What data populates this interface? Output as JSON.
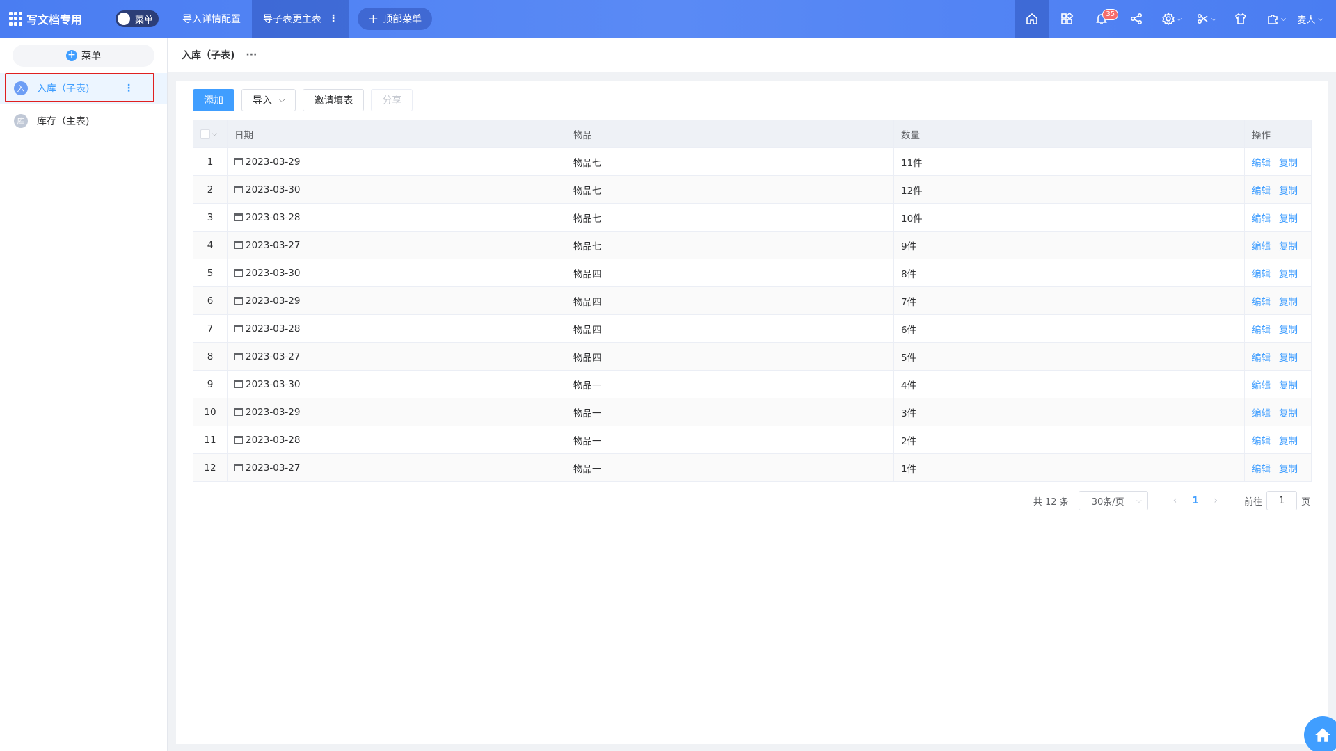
{
  "app": {
    "title": "写文档专用",
    "menu_toggle_label": "菜单"
  },
  "top_nav": {
    "tabs": [
      {
        "label": "导入详情配置"
      },
      {
        "label": "导子表更主表",
        "more": "⋮"
      }
    ],
    "add_menu_label": "顶部菜单",
    "notification_count": "35",
    "user_label": "麦人"
  },
  "sidebar": {
    "menu_button_label": "菜单",
    "items": [
      {
        "avatar": "入",
        "label": "入库（子表)",
        "more": "⋮"
      },
      {
        "avatar": "库",
        "label": "库存（主表)"
      }
    ]
  },
  "breadcrumb": {
    "title": "入库（子表)",
    "more": "···"
  },
  "toolbar": {
    "add_label": "添加",
    "import_label": "导入",
    "invite_label": "邀请填表",
    "share_label": "分享"
  },
  "table": {
    "columns": [
      "日期",
      "物品",
      "数量",
      "操作"
    ],
    "action_labels": {
      "edit": "编辑",
      "copy": "复制"
    },
    "rows": [
      {
        "no": "1",
        "date": "2023-03-29",
        "item": "物品七",
        "qty": "11件"
      },
      {
        "no": "2",
        "date": "2023-03-30",
        "item": "物品七",
        "qty": "12件"
      },
      {
        "no": "3",
        "date": "2023-03-28",
        "item": "物品七",
        "qty": "10件"
      },
      {
        "no": "4",
        "date": "2023-03-27",
        "item": "物品七",
        "qty": "9件"
      },
      {
        "no": "5",
        "date": "2023-03-30",
        "item": "物品四",
        "qty": "8件"
      },
      {
        "no": "6",
        "date": "2023-03-29",
        "item": "物品四",
        "qty": "7件"
      },
      {
        "no": "7",
        "date": "2023-03-28",
        "item": "物品四",
        "qty": "6件"
      },
      {
        "no": "8",
        "date": "2023-03-27",
        "item": "物品四",
        "qty": "5件"
      },
      {
        "no": "9",
        "date": "2023-03-30",
        "item": "物品一",
        "qty": "4件"
      },
      {
        "no": "10",
        "date": "2023-03-29",
        "item": "物品一",
        "qty": "3件"
      },
      {
        "no": "11",
        "date": "2023-03-28",
        "item": "物品一",
        "qty": "2件"
      },
      {
        "no": "12",
        "date": "2023-03-27",
        "item": "物品一",
        "qty": "1件"
      }
    ]
  },
  "pagination": {
    "total_label": "共 12 条",
    "page_size_label": "30条/页",
    "current_page": "1",
    "goto_prefix": "前往",
    "goto_value": "1",
    "goto_suffix": "页"
  },
  "colors": {
    "primary": "#409eff",
    "topbar": "#4a7df2",
    "highlight": "#e02020",
    "badge": "#f56c6c"
  }
}
